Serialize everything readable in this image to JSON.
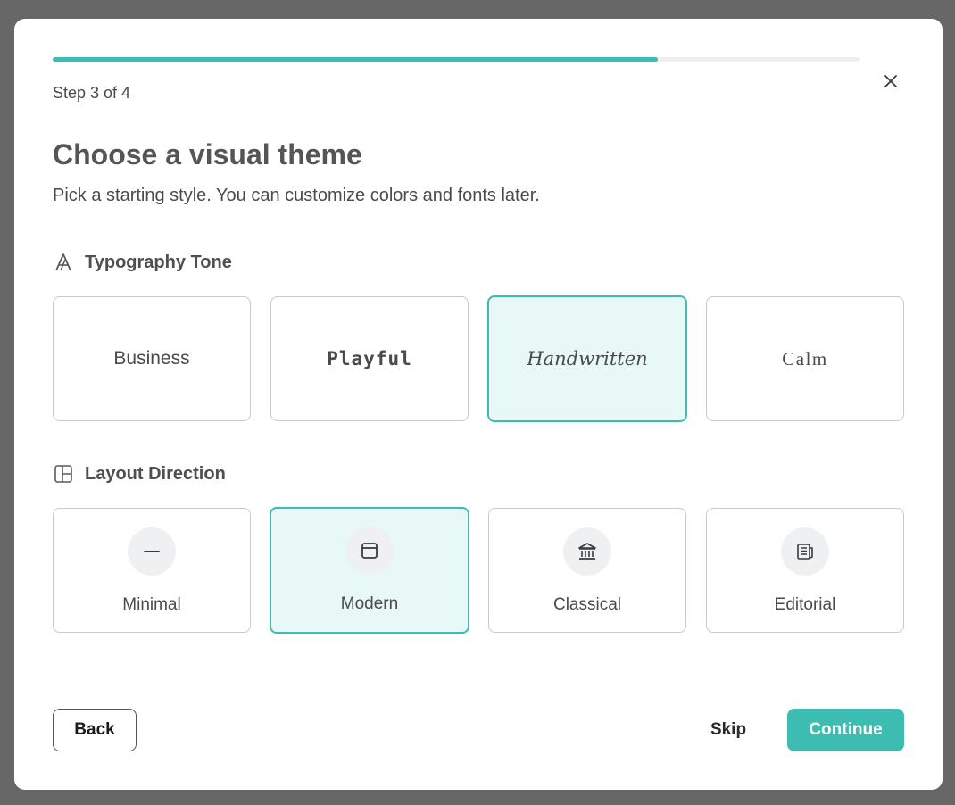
{
  "progress": {
    "value": 0.75
  },
  "step_label": "Step 3 of 4",
  "title": "Choose a visual theme",
  "subtitle": "Pick a starting style. You can customize colors and fonts later.",
  "typography": {
    "heading": "Typography Tone",
    "icon": "typography-icon",
    "options": [
      {
        "label": "Business",
        "selected": false
      },
      {
        "label": "Playful",
        "selected": false
      },
      {
        "label": "Handwritten",
        "selected": true
      },
      {
        "label": "Calm",
        "selected": false
      }
    ]
  },
  "layout": {
    "heading": "Layout Direction",
    "icon": "layout-icon",
    "options": [
      {
        "label": "Minimal",
        "icon": "minus-icon",
        "selected": false
      },
      {
        "label": "Modern",
        "icon": "window-icon",
        "selected": true
      },
      {
        "label": "Classical",
        "icon": "columns-building-icon",
        "selected": false
      },
      {
        "label": "Editorial",
        "icon": "newspaper-icon",
        "selected": false
      }
    ]
  },
  "buttons": {
    "back": "Back",
    "skip": "Skip",
    "continue": "Continue"
  },
  "colors": {
    "accent": "#3dbcb1",
    "selected_bg": "#e7f8f6",
    "overlay": "#676767"
  }
}
